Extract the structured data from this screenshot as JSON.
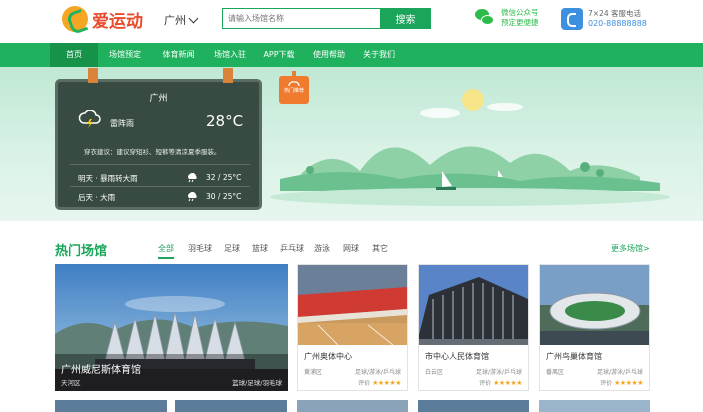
{
  "header": {
    "logo_text": "爱运动",
    "city": "广州",
    "search_placeholder": "请输入场馆名称",
    "search_button": "搜索",
    "wechat_line1": "微信公众号",
    "wechat_line2": "预定更便捷",
    "phone_line1": "7×24 客服电话",
    "phone_number": "020-88888888"
  },
  "nav": {
    "items": [
      "首页",
      "场馆预定",
      "体育新闻",
      "场馆入驻",
      "APP下载",
      "使用帮助",
      "关于我们"
    ],
    "active_index": 0
  },
  "weather": {
    "city": "广州",
    "icon": "thunderstorm-icon",
    "desc": "雷阵雨",
    "temp": "28°C",
    "advice": "穿衣建议：建议穿短衫、短裤等清凉夏季服装。",
    "forecast": [
      {
        "day": "明天 · 暴雨转大雨",
        "icon": "rain-cloud-icon",
        "temp": "32 / 25°C"
      },
      {
        "day": "后天 · 大雨",
        "icon": "rain-cloud-icon",
        "temp": "30 / 25°C"
      }
    ]
  },
  "banner_badge": "热门推荐",
  "section": {
    "title": "热门场馆",
    "tabs": [
      "全部",
      "羽毛球",
      "足球",
      "篮球",
      "乒乓球",
      "游泳",
      "网球",
      "其它"
    ],
    "active_tab": 0,
    "more": "更多场馆>"
  },
  "feature": {
    "title": "广州威尼斯体育馆",
    "area": "天河区",
    "tags": "篮球/足球/羽毛球"
  },
  "cards": [
    {
      "name": "广州奥体中心",
      "area": "黄浦区",
      "tags": "足球/游泳/乒乓球",
      "rating_label": "评价",
      "stars": "★★★★★"
    },
    {
      "name": "市中心人民体育馆",
      "area": "白云区",
      "tags": "足球/游泳/乒乓球",
      "rating_label": "评价",
      "stars": "★★★★★"
    },
    {
      "name": "广州鸟巢体育馆",
      "area": "番禺区",
      "tags": "足球/游泳/乒乓球",
      "rating_label": "评价",
      "stars": "★★★★★"
    }
  ],
  "colors": {
    "brand_green": "#1aa55a",
    "nav_green": "#1fb15e",
    "star": "#f5a623"
  }
}
